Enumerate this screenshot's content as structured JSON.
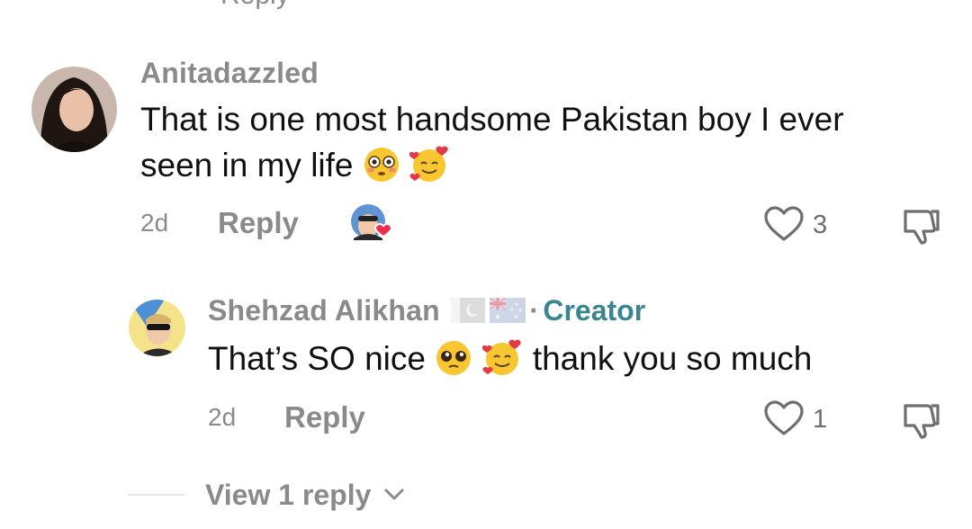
{
  "top": {
    "partial_text": "Reply"
  },
  "comment": {
    "username": "Anitadazzled",
    "text_line1": "That is one most handsome Pakistan boy I ever",
    "text_line2": "seen in my life",
    "time": "2d",
    "reply_label": "Reply",
    "like_count": "3",
    "icons": {
      "like": "heart-outline",
      "dislike": "thumbs-down-outline",
      "creator_liked": "creator-avatar-with-heart"
    }
  },
  "reply": {
    "username": "Shehzad Alikhan",
    "flags": [
      "pakistan-flag",
      "australia-flag"
    ],
    "separator": "·",
    "badge": "Creator",
    "text_before": "That’s SO nice",
    "text_after": "thank you so much",
    "time": "2d",
    "reply_label": "Reply",
    "like_count": "1"
  },
  "view_more": {
    "label": "View 1 reply"
  },
  "colors": {
    "accent_creator": "#3b8592",
    "muted": "#8a8a8a",
    "heart": "#ee2d4f"
  }
}
